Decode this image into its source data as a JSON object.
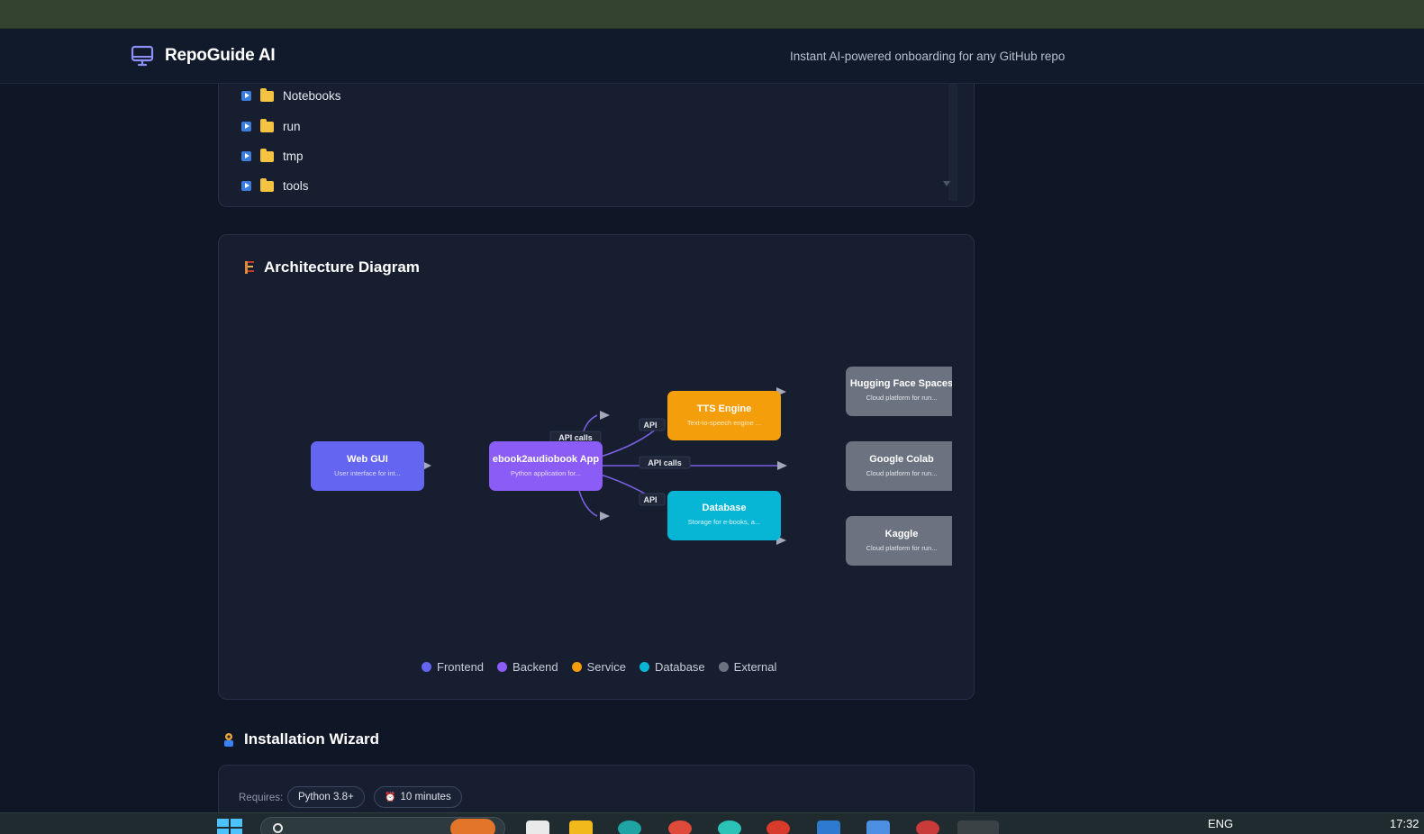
{
  "header": {
    "brand_name": "RepoGuide AI",
    "tagline": "Instant AI-powered onboarding for any GitHub repo",
    "brand_icon": "monitor-icon"
  },
  "file_tree": {
    "items": [
      {
        "label": "Notebooks"
      },
      {
        "label": "run"
      },
      {
        "label": "tmp"
      },
      {
        "label": "tools"
      }
    ]
  },
  "architecture": {
    "title": "Architecture Diagram",
    "title_icon": "building-icon",
    "nodes": [
      {
        "id": "web-gui",
        "title": "Web GUI",
        "desc": "User interface for int...",
        "color": "#6466f1"
      },
      {
        "id": "app",
        "title": "ebook2audiobook App",
        "desc": "Python application for...",
        "color": "#8b5cf6"
      },
      {
        "id": "tts",
        "title": "TTS Engine",
        "desc": "Text-to-speech engine ...",
        "color": "#f59e0b"
      },
      {
        "id": "db",
        "title": "Database",
        "desc": "Storage for e-books, a...",
        "color": "#06b6d4"
      },
      {
        "id": "hf",
        "title": "Hugging Face Spaces",
        "desc": "Cloud platform for run...",
        "color": "#6b7280"
      },
      {
        "id": "colab",
        "title": "Google Colab",
        "desc": "Cloud platform for run...",
        "color": "#6b7280"
      },
      {
        "id": "kaggle",
        "title": "Kaggle",
        "desc": "Cloud platform for run...",
        "color": "#6b7280"
      }
    ],
    "edge_labels": {
      "top": "API calls",
      "tts": "API",
      "middle": "API calls",
      "db": "API"
    },
    "legend": [
      {
        "label": "Frontend",
        "color": "#6466f1"
      },
      {
        "label": "Backend",
        "color": "#8b5cf6"
      },
      {
        "label": "Service",
        "color": "#f59e0b"
      },
      {
        "label": "Database",
        "color": "#06b6d4"
      },
      {
        "label": "External",
        "color": "#6b7280"
      }
    ]
  },
  "installation": {
    "title": "Installation Wizard",
    "title_icon": "wizard-icon",
    "requires_label": "Requires:",
    "python_pill": "Python 3.8+",
    "time_pill": "10 minutes",
    "time_icon": "alarm-clock-icon"
  },
  "taskbar": {
    "language": "ENG",
    "clock": "17:32"
  }
}
